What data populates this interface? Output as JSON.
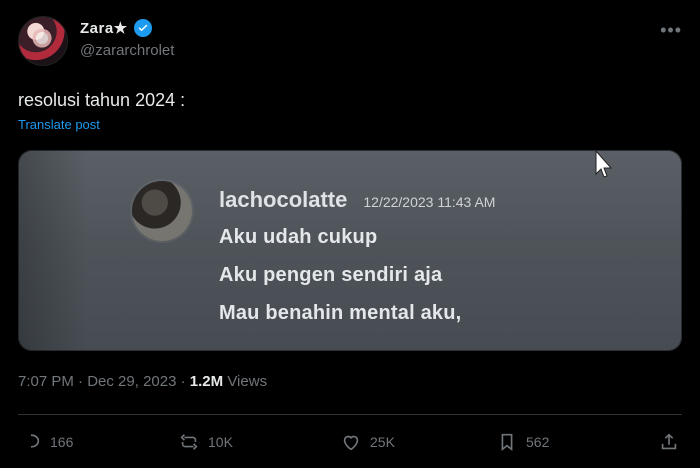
{
  "post": {
    "author": {
      "display_name": "Zara★",
      "handle": "@zararchrolet"
    },
    "text": "resolusi tahun 2024 :",
    "translate_label": "Translate post",
    "media": {
      "username": "lachocolatte",
      "timestamp": "12/22/2023 11:43 AM",
      "lines": [
        "Aku udah cukup",
        "Aku pengen sendiri aja",
        "Mau benahin mental aku,"
      ]
    },
    "meta": {
      "time": "7:07 PM",
      "separator_1": "·",
      "date": "Dec 29, 2023",
      "separator_2": "·",
      "views_count": "1.2M",
      "views_label": "Views"
    },
    "actions": {
      "reply": "166",
      "repost": "10K",
      "like": "25K",
      "bookmark": "562"
    }
  },
  "icons": {
    "verified": "verified-badge-icon",
    "more": "more-icon",
    "reply": "reply-icon",
    "repost": "repost-icon",
    "like": "like-icon",
    "bookmark": "bookmark-icon",
    "share": "share-icon"
  },
  "colors": {
    "background": "#000000",
    "text": "#e7e9ea",
    "secondary": "#71767b",
    "accent": "#1d9bf0",
    "divider": "#2f3336"
  }
}
